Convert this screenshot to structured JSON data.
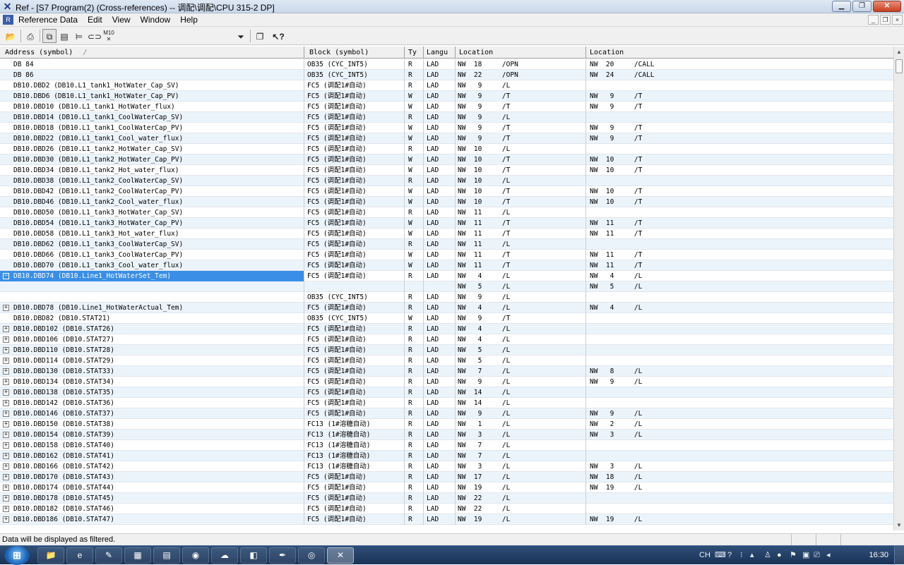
{
  "window": {
    "title": "Ref - [S7 Program(2) (Cross-references) -- 调配\\调配\\CPU 315-2 DP]",
    "controls": [
      "minimize",
      "maximize",
      "close"
    ]
  },
  "menu": {
    "items": [
      "Reference Data",
      "Edit",
      "View",
      "Window",
      "Help"
    ]
  },
  "toolbar": {
    "filter_value": "Filtered",
    "pressed_button": "cross-references-view"
  },
  "table": {
    "columns": [
      "Address (symbol)",
      "Block (symbol)",
      "Ty",
      "Langu",
      "Location",
      "Location"
    ],
    "sort_indicator": "/",
    "rows": [
      {
        "exp": "",
        "addr": "DB 84",
        "blk": "OB35 (CYC_INT5)",
        "ty": "R",
        "lang": "LAD",
        "loc1": "NW  18     /OPN",
        "loc2": "NW  20     /CALL"
      },
      {
        "exp": "",
        "addr": "DB 86",
        "blk": "OB35 (CYC_INT5)",
        "ty": "R",
        "lang": "LAD",
        "loc1": "NW  22     /OPN",
        "loc2": "NW  24     /CALL"
      },
      {
        "exp": "",
        "addr": "DB10.DBD2 (DB10.L1_tank1_HotWater_Cap_SV)",
        "blk": "FC5 (调配1#自动)",
        "ty": "R",
        "lang": "LAD",
        "loc1": "NW   9     /L",
        "loc2": ""
      },
      {
        "exp": "",
        "addr": "DB10.DBD6 (DB10.L1_tank1_HotWater_Cap_PV)",
        "blk": "FC5 (调配1#自动)",
        "ty": "W",
        "lang": "LAD",
        "loc1": "NW   9     /T",
        "loc2": "NW   9     /T"
      },
      {
        "exp": "",
        "addr": "DB10.DBD10 (DB10.L1_tank1_HotWater_flux)",
        "blk": "FC5 (调配1#自动)",
        "ty": "W",
        "lang": "LAD",
        "loc1": "NW   9     /T",
        "loc2": "NW   9     /T"
      },
      {
        "exp": "",
        "addr": "DB10.DBD14 (DB10.L1_tank1_CoolWaterCap_SV)",
        "blk": "FC5 (调配1#自动)",
        "ty": "R",
        "lang": "LAD",
        "loc1": "NW   9     /L",
        "loc2": ""
      },
      {
        "exp": "",
        "addr": "DB10.DBD18 (DB10.L1_tank1_CoolWaterCap_PV)",
        "blk": "FC5 (调配1#自动)",
        "ty": "W",
        "lang": "LAD",
        "loc1": "NW   9     /T",
        "loc2": "NW   9     /T"
      },
      {
        "exp": "",
        "addr": "DB10.DBD22 (DB10.L1_tank1_Cool_water_flux)",
        "blk": "FC5 (调配1#自动)",
        "ty": "W",
        "lang": "LAD",
        "loc1": "NW   9     /T",
        "loc2": "NW   9     /T"
      },
      {
        "exp": "",
        "addr": "DB10.DBD26 (DB10.L1_tank2_HotWater_Cap_SV)",
        "blk": "FC5 (调配1#自动)",
        "ty": "R",
        "lang": "LAD",
        "loc1": "NW  10     /L",
        "loc2": ""
      },
      {
        "exp": "",
        "addr": "DB10.DBD30 (DB10.L1_tank2_HotWater_Cap_PV)",
        "blk": "FC5 (调配1#自动)",
        "ty": "W",
        "lang": "LAD",
        "loc1": "NW  10     /T",
        "loc2": "NW  10     /T"
      },
      {
        "exp": "",
        "addr": "DB10.DBD34 (DB10.L1_tank2_Hot_water_flux)",
        "blk": "FC5 (调配1#自动)",
        "ty": "W",
        "lang": "LAD",
        "loc1": "NW  10     /T",
        "loc2": "NW  10     /T"
      },
      {
        "exp": "",
        "addr": "DB10.DBD38 (DB10.L1_tank2_CoolWaterCap_SV)",
        "blk": "FC5 (调配1#自动)",
        "ty": "R",
        "lang": "LAD",
        "loc1": "NW  10     /L",
        "loc2": ""
      },
      {
        "exp": "",
        "addr": "DB10.DBD42 (DB10.L1_tank2_CoolWaterCap_PV)",
        "blk": "FC5 (调配1#自动)",
        "ty": "W",
        "lang": "LAD",
        "loc1": "NW  10     /T",
        "loc2": "NW  10     /T"
      },
      {
        "exp": "",
        "addr": "DB10.DBD46 (DB10.L1_tank2_Cool_water_flux)",
        "blk": "FC5 (调配1#自动)",
        "ty": "W",
        "lang": "LAD",
        "loc1": "NW  10     /T",
        "loc2": "NW  10     /T"
      },
      {
        "exp": "",
        "addr": "DB10.DBD50 (DB10.L1_tank3_HotWater_Cap_SV)",
        "blk": "FC5 (调配1#自动)",
        "ty": "R",
        "lang": "LAD",
        "loc1": "NW  11     /L",
        "loc2": ""
      },
      {
        "exp": "",
        "addr": "DB10.DBD54 (DB10.L1_tank3_HotWater_Cap_PV)",
        "blk": "FC5 (调配1#自动)",
        "ty": "W",
        "lang": "LAD",
        "loc1": "NW  11     /T",
        "loc2": "NW  11     /T"
      },
      {
        "exp": "",
        "addr": "DB10.DBD58 (DB10.L1_tank3_Hot_water_flux)",
        "blk": "FC5 (调配1#自动)",
        "ty": "W",
        "lang": "LAD",
        "loc1": "NW  11     /T",
        "loc2": "NW  11     /T"
      },
      {
        "exp": "",
        "addr": "DB10.DBD62 (DB10.L1_tank3_CoolWaterCap_SV)",
        "blk": "FC5 (调配1#自动)",
        "ty": "R",
        "lang": "LAD",
        "loc1": "NW  11     /L",
        "loc2": ""
      },
      {
        "exp": "",
        "addr": "DB10.DBD66 (DB10.L1_tank3_CoolWaterCap_PV)",
        "blk": "FC5 (调配1#自动)",
        "ty": "W",
        "lang": "LAD",
        "loc1": "NW  11     /T",
        "loc2": "NW  11     /T"
      },
      {
        "exp": "",
        "addr": "DB10.DBD70 (DB10.L1_tank3_Cool_water_flux)",
        "blk": "FC5 (调配1#自动)",
        "ty": "W",
        "lang": "LAD",
        "loc1": "NW  11     /T",
        "loc2": "NW  11     /T"
      },
      {
        "exp": "−",
        "sel": true,
        "addr": "DB10.DBD74 (DB10.Line1_HotWaterSet_Tem)",
        "blk": "FC5 (调配1#自动)",
        "ty": "R",
        "lang": "LAD",
        "loc1": "NW   4     /L",
        "loc2": "NW   4     /L"
      },
      {
        "exp": "",
        "addr": "",
        "blk": "",
        "ty": "",
        "lang": "",
        "loc1": "NW   5     /L",
        "loc2": "NW   5     /L"
      },
      {
        "exp": "",
        "addr": "",
        "blk": "OB35 (CYC_INT5)",
        "ty": "R",
        "lang": "LAD",
        "loc1": "NW   9     /L",
        "loc2": ""
      },
      {
        "exp": "+",
        "addr": "DB10.DBD78 (DB10.Line1_HotWaterActual_Tem)",
        "blk": "FC5 (调配1#自动)",
        "ty": "R",
        "lang": "LAD",
        "loc1": "NW   4     /L",
        "loc2": "NW   4     /L"
      },
      {
        "exp": "",
        "addr": "DB10.DBD82 (DB10.STAT21)",
        "blk": "OB35 (CYC_INT5)",
        "ty": "W",
        "lang": "LAD",
        "loc1": "NW   9     /T",
        "loc2": ""
      },
      {
        "exp": "+",
        "addr": "DB10.DBD102 (DB10.STAT26)",
        "blk": "FC5 (调配1#自动)",
        "ty": "R",
        "lang": "LAD",
        "loc1": "NW   4     /L",
        "loc2": ""
      },
      {
        "exp": "+",
        "addr": "DB10.DBD106 (DB10.STAT27)",
        "blk": "FC5 (调配1#自动)",
        "ty": "R",
        "lang": "LAD",
        "loc1": "NW   4     /L",
        "loc2": ""
      },
      {
        "exp": "+",
        "addr": "DB10.DBD110 (DB10.STAT28)",
        "blk": "FC5 (调配1#自动)",
        "ty": "R",
        "lang": "LAD",
        "loc1": "NW   5     /L",
        "loc2": ""
      },
      {
        "exp": "+",
        "addr": "DB10.DBD114 (DB10.STAT29)",
        "blk": "FC5 (调配1#自动)",
        "ty": "R",
        "lang": "LAD",
        "loc1": "NW   5     /L",
        "loc2": ""
      },
      {
        "exp": "+",
        "addr": "DB10.DBD130 (DB10.STAT33)",
        "blk": "FC5 (调配1#自动)",
        "ty": "R",
        "lang": "LAD",
        "loc1": "NW   7     /L",
        "loc2": "NW   8     /L"
      },
      {
        "exp": "+",
        "addr": "DB10.DBD134 (DB10.STAT34)",
        "blk": "FC5 (调配1#自动)",
        "ty": "R",
        "lang": "LAD",
        "loc1": "NW   9     /L",
        "loc2": "NW   9     /L"
      },
      {
        "exp": "+",
        "addr": "DB10.DBD138 (DB10.STAT35)",
        "blk": "FC5 (调配1#自动)",
        "ty": "R",
        "lang": "LAD",
        "loc1": "NW  14     /L",
        "loc2": ""
      },
      {
        "exp": "+",
        "addr": "DB10.DBD142 (DB10.STAT36)",
        "blk": "FC5 (调配1#自动)",
        "ty": "R",
        "lang": "LAD",
        "loc1": "NW  14     /L",
        "loc2": ""
      },
      {
        "exp": "+",
        "addr": "DB10.DBD146 (DB10.STAT37)",
        "blk": "FC5 (调配1#自动)",
        "ty": "R",
        "lang": "LAD",
        "loc1": "NW   9     /L",
        "loc2": "NW   9     /L"
      },
      {
        "exp": "+",
        "addr": "DB10.DBD150 (DB10.STAT38)",
        "blk": "FC13 (1#溶糖自动)",
        "ty": "R",
        "lang": "LAD",
        "loc1": "NW   1     /L",
        "loc2": "NW   2     /L"
      },
      {
        "exp": "+",
        "addr": "DB10.DBD154 (DB10.STAT39)",
        "blk": "FC13 (1#溶糖自动)",
        "ty": "R",
        "lang": "LAD",
        "loc1": "NW   3     /L",
        "loc2": "NW   3     /L"
      },
      {
        "exp": "+",
        "addr": "DB10.DBD158 (DB10.STAT40)",
        "blk": "FC13 (1#溶糖自动)",
        "ty": "R",
        "lang": "LAD",
        "loc1": "NW   7     /L",
        "loc2": ""
      },
      {
        "exp": "+",
        "addr": "DB10.DBD162 (DB10.STAT41)",
        "blk": "FC13 (1#溶糖自动)",
        "ty": "R",
        "lang": "LAD",
        "loc1": "NW   7     /L",
        "loc2": ""
      },
      {
        "exp": "+",
        "addr": "DB10.DBD166 (DB10.STAT42)",
        "blk": "FC13 (1#溶糖自动)",
        "ty": "R",
        "lang": "LAD",
        "loc1": "NW   3     /L",
        "loc2": "NW   3     /L"
      },
      {
        "exp": "+",
        "addr": "DB10.DBD170 (DB10.STAT43)",
        "blk": "FC5 (调配1#自动)",
        "ty": "R",
        "lang": "LAD",
        "loc1": "NW  17     /L",
        "loc2": "NW  18     /L"
      },
      {
        "exp": "+",
        "addr": "DB10.DBD174 (DB10.STAT44)",
        "blk": "FC5 (调配1#自动)",
        "ty": "R",
        "lang": "LAD",
        "loc1": "NW  19     /L",
        "loc2": "NW  19     /L"
      },
      {
        "exp": "+",
        "addr": "DB10.DBD178 (DB10.STAT45)",
        "blk": "FC5 (调配1#自动)",
        "ty": "R",
        "lang": "LAD",
        "loc1": "NW  22     /L",
        "loc2": ""
      },
      {
        "exp": "+",
        "addr": "DB10.DBD182 (DB10.STAT46)",
        "blk": "FC5 (调配1#自动)",
        "ty": "R",
        "lang": "LAD",
        "loc1": "NW  22     /L",
        "loc2": ""
      },
      {
        "exp": "+",
        "addr": "DB10.DBD186 (DB10.STAT47)",
        "blk": "FC5 (调配1#自动)",
        "ty": "R",
        "lang": "LAD",
        "loc1": "NW  19     /L",
        "loc2": "NW  19     /L"
      }
    ]
  },
  "status": {
    "message": "Data will be displayed as filtered."
  },
  "taskbar": {
    "items": [
      "folder-icon",
      "browser-icon",
      "document-icon",
      "explorer-icon",
      "calculator-icon",
      "chrome-icon",
      "weather-icon",
      "app-icon",
      "pen-icon",
      "network-icon",
      "simatic-ref-icon"
    ],
    "language": "CH",
    "clock": "16:30"
  }
}
